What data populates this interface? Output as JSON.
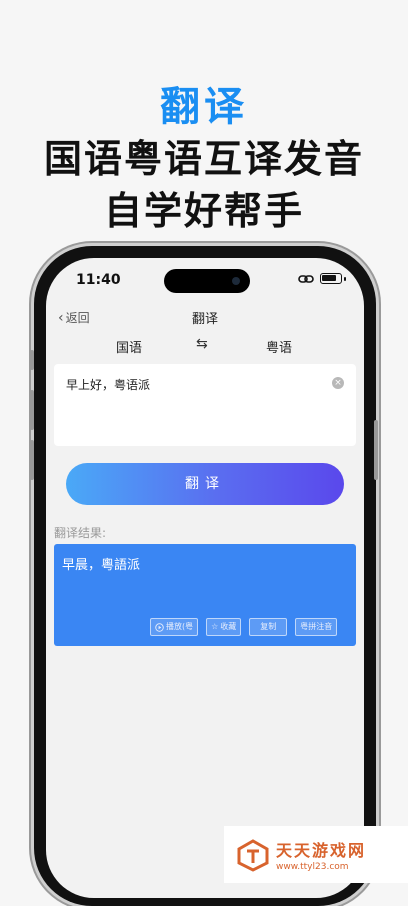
{
  "headline": {
    "line1": "翻译",
    "line2": "国语粤语互译发音",
    "line3": "自学好帮手"
  },
  "status_bar": {
    "time": "11:40"
  },
  "nav": {
    "back_label": "返回",
    "title": "翻译"
  },
  "languages": {
    "source": "国语",
    "swap_symbol": "⇆",
    "target": "粤语"
  },
  "input": {
    "text": "早上好，粤语派"
  },
  "translate_button": {
    "label": "翻译"
  },
  "result": {
    "label": "翻译结果:",
    "text": "早晨，粵語派",
    "actions": {
      "play": "播放(粤",
      "favorite": "收藏",
      "copy": "复制",
      "pinyin": "粤拼注音"
    }
  },
  "watermark": {
    "name": "天天游戏网",
    "url": "www.ttyl23.com"
  },
  "colors": {
    "accent": "#1a8ef2",
    "result_bg": "#3a86f3",
    "watermark": "#d8632d"
  }
}
